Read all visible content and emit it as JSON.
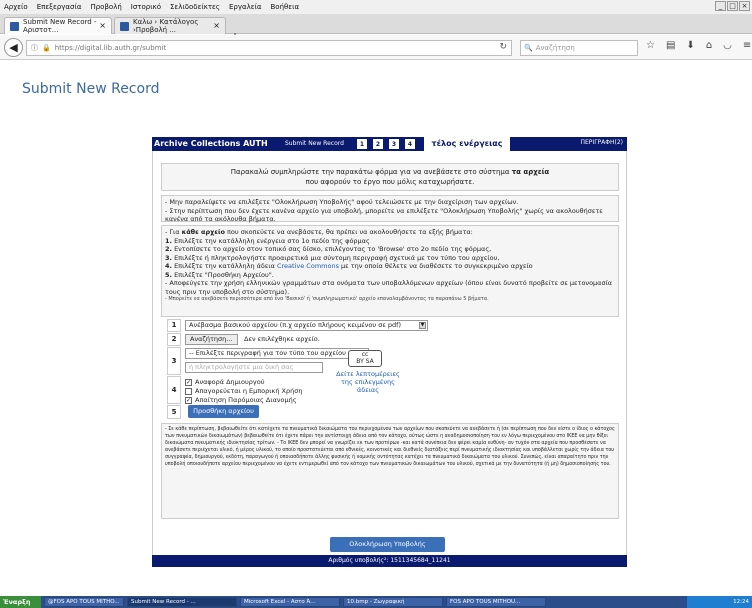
{
  "menu": [
    "Αρχείο",
    "Επεξεργασία",
    "Προβολή",
    "Ιστορικό",
    "Σελιδοδείκτες",
    "Εργαλεία",
    "Βοήθεια"
  ],
  "tabs": [
    {
      "label": "Submit New Record - Αριστοτ..."
    },
    {
      "label": "Καλω › Κατάλογος ›Προβολή ..."
    }
  ],
  "newtab_symbol": "+",
  "url": "https://digital.lib.auth.gr/submit",
  "search_placeholder": "Αναζήτηση",
  "page_title": "Submit New Record",
  "header": {
    "title": "Archive Collections AUTH",
    "subtitle": "Submit New Record",
    "steps": [
      "1",
      "2",
      "3",
      "4"
    ],
    "end_label": "τέλος ενέργειας",
    "description_label": "ΠΕΡΙΓΡΑΦΗ(2)"
  },
  "intro": {
    "line1": "Παρακαλώ συμπληρώστε την παρακάτω φόρμα για να ανεβάσετε στο σύστημα ",
    "line1_bold": "τα αρχεία",
    "line2": "που αφορούν το έργο που μόλις καταχωρήσατε."
  },
  "info1": [
    "- Μην παραλείψετε να επιλέξετε \"Ολοκλήρωση Υποβολής\" αφού τελειώσετε με την διαχείριση των αρχείων.",
    "- Στην περίπτωση που δεν έχετε κανένα αρχείο για υποβολή, μπορείτε να επιλέξετε \"Ολοκλήρωση Υποβολής\" χωρίς να ακολουθήσετε κανένα από τα ακόλουθα βήματα."
  ],
  "info2": {
    "intro_pre": "- Για ",
    "intro_bold": "κάθε αρχείο",
    "intro_post": " που σκοπεύετε να ανεβάσετε, θα πρέπει να ακολουθήσετε τα εξής βήματα:",
    "steps": [
      {
        "n": "1.",
        "text": " Επιλέξτε την κατάλληλη ενέργεια στο 1ο πεδίο της φόρμας"
      },
      {
        "n": "2.",
        "text": " Εντοπίσετε το αρχείο στον τοπικό σας δίσκο, επιλέγοντας το 'Browse' στο 2ο πεδίο της φόρμας,"
      },
      {
        "n": "3.",
        "text": " Επιλέξτε ή πληκτρολογήστε προαιρετικά μια σύντομη περιγραφή σχετικά με τον τύπο του αρχείου,"
      },
      {
        "n": "4.",
        "text": " Επιλέξτε την κατάλληλη άδεια "
      },
      {
        "n": "5.",
        "text": " Επιλέξτε \"Προσθήκη Αρχείου\"."
      }
    ],
    "cc_link": "Creative Commons",
    "step4_post": " με την οποία θέλετε να διαθέσετε το συγκεκριμένο αρχείο",
    "avoid": "- Αποφεύγετε την χρήση ελληνικών γραμμάτων στα ονόματα των υποβαλλόμενων αρχείων (όπου είναι δυνατό προβείτε σε μετονομασία τους πριν την υποβολή στο σύστημα).",
    "small": "- Μπορείτε να ανεβάσετε περισσότερα από ένα 'Βασικό' ή 'συμπληρωματικό' αρχείο επαναλαμβάνοντας τα παραπάνω 5 βήματα."
  },
  "form": {
    "row_numbers": [
      "1",
      "2",
      "3",
      "4",
      "5"
    ],
    "action_select": "Ανέβασμα βασικού αρχείου (π.χ αρχείο πλήρους κειμένου σε pdf)",
    "browse_button": "Αναζήτηση...",
    "no_file": "Δεν επιλέχθηκε αρχείο.",
    "description_select": "-- Επιλέξτε περιγραφή για τον τύπο του αρχείου --",
    "description_placeholder": "ή πληκτρολογήστε μια δική σας",
    "checkboxes": [
      {
        "label": "Αναφορά Δημιουργού",
        "checked": true
      },
      {
        "label": "Απαγορεύεται η Εμπορική Χρήση",
        "checked": false
      },
      {
        "label": "Απαίτηση Παρόμοιας Διανομής",
        "checked": true
      }
    ],
    "cc_logo_text": "cc",
    "cc_logo_sub": "BY SA",
    "license_link": "Δείτε λεπτομέρειες της επιλεγμένης άδειας",
    "add_button": "Προσθήκη αρχείου"
  },
  "legal_text": "- Σε κάθε περίπτωση, βεβαιωθείτε ότι κατέχετε τα πνευματικά δικαιώματα του περιεχομένου των αρχείων που σκοπεύετε να ανεβάσετε ή (σε περίπτωση που δεν είστε ο ίδιος ο κάτοχος των πνευματικών δικαιωμάτων) βεβαιωθείτε ότι έχετε πάρει την αντίστοιχη άδεια από τον κάτοχο, ούτως ώστε η αναδημοσιοποίηση του εν λόγω περιεχομένου στο ΙΚΕΕ να μην θίξει δικαιώματα πνευματικής ιδιοκτησίας τρίτων. - Το ΙΚΕΕ δεν μπορεί να γνωρίζει εκ των προτέρων -και κατά συνέπεια δεν φέρει καμία ευθύνη- αν τυχόν στα αρχεία που προσθέσατε να ανεβάσετε περιέχεται υλικό, ή μέρος υλικού, το οποίο προστατεύεται από εθνικές, κοινοτικές και διεθνείς διατάξεις περί πνευματικής ιδιοκτησίας και υποβάλλεται χωρίς την άδεια του συγγραφέα, δημιουργού, εκδότη, παραγωγού ή οποιασδήποτε άλλης φυσικής ή νομικής οντότητας κατέχει τα πνευματικά δικαιώματα του υλικού. Συνεπώς, είναι απαραίτητο πριν την υποβολή οποιουδήποτε αρχείου περιεχομένου να έχετε εντιμερωθεί από τον κάτοχο των πνευματικών δικαιωμάτων του υλικού, σχετικά με την δυνατότητα (ή μη) δημοσιοποίησής του.",
  "submit_button": "Ολοκλήρωση Υποβολής",
  "footer": "Αριθμός υποβολής²: 1511345684_11241",
  "taskbar": {
    "start": "Έναρξη",
    "items": [
      "@FOS APO TOUS MITHO...",
      "Submit New Record - ...",
      "Microsoft Excel - Αστο Ά...",
      "10.bmp - Ζωγραφική",
      "FOS APO TOUS MITHOU..."
    ],
    "clock": "12:24"
  },
  "colors": {
    "accent": "#0a1a6e",
    "link": "#3b6aa0",
    "button": "#3b6fb8"
  }
}
